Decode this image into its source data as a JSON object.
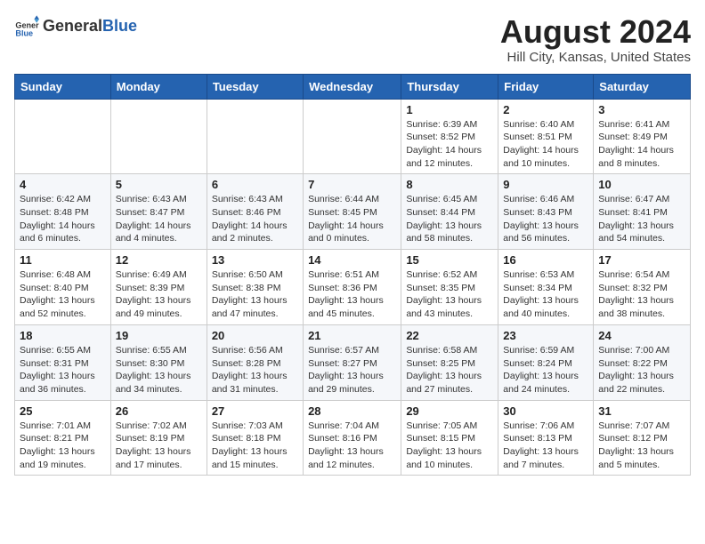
{
  "header": {
    "logo_general": "General",
    "logo_blue": "Blue",
    "month_year": "August 2024",
    "location": "Hill City, Kansas, United States"
  },
  "days_of_week": [
    "Sunday",
    "Monday",
    "Tuesday",
    "Wednesday",
    "Thursday",
    "Friday",
    "Saturday"
  ],
  "weeks": [
    [
      {
        "day": "",
        "info": ""
      },
      {
        "day": "",
        "info": ""
      },
      {
        "day": "",
        "info": ""
      },
      {
        "day": "",
        "info": ""
      },
      {
        "day": "1",
        "info": "Sunrise: 6:39 AM\nSunset: 8:52 PM\nDaylight: 14 hours and 12 minutes."
      },
      {
        "day": "2",
        "info": "Sunrise: 6:40 AM\nSunset: 8:51 PM\nDaylight: 14 hours and 10 minutes."
      },
      {
        "day": "3",
        "info": "Sunrise: 6:41 AM\nSunset: 8:49 PM\nDaylight: 14 hours and 8 minutes."
      }
    ],
    [
      {
        "day": "4",
        "info": "Sunrise: 6:42 AM\nSunset: 8:48 PM\nDaylight: 14 hours and 6 minutes."
      },
      {
        "day": "5",
        "info": "Sunrise: 6:43 AM\nSunset: 8:47 PM\nDaylight: 14 hours and 4 minutes."
      },
      {
        "day": "6",
        "info": "Sunrise: 6:43 AM\nSunset: 8:46 PM\nDaylight: 14 hours and 2 minutes."
      },
      {
        "day": "7",
        "info": "Sunrise: 6:44 AM\nSunset: 8:45 PM\nDaylight: 14 hours and 0 minutes."
      },
      {
        "day": "8",
        "info": "Sunrise: 6:45 AM\nSunset: 8:44 PM\nDaylight: 13 hours and 58 minutes."
      },
      {
        "day": "9",
        "info": "Sunrise: 6:46 AM\nSunset: 8:43 PM\nDaylight: 13 hours and 56 minutes."
      },
      {
        "day": "10",
        "info": "Sunrise: 6:47 AM\nSunset: 8:41 PM\nDaylight: 13 hours and 54 minutes."
      }
    ],
    [
      {
        "day": "11",
        "info": "Sunrise: 6:48 AM\nSunset: 8:40 PM\nDaylight: 13 hours and 52 minutes."
      },
      {
        "day": "12",
        "info": "Sunrise: 6:49 AM\nSunset: 8:39 PM\nDaylight: 13 hours and 49 minutes."
      },
      {
        "day": "13",
        "info": "Sunrise: 6:50 AM\nSunset: 8:38 PM\nDaylight: 13 hours and 47 minutes."
      },
      {
        "day": "14",
        "info": "Sunrise: 6:51 AM\nSunset: 8:36 PM\nDaylight: 13 hours and 45 minutes."
      },
      {
        "day": "15",
        "info": "Sunrise: 6:52 AM\nSunset: 8:35 PM\nDaylight: 13 hours and 43 minutes."
      },
      {
        "day": "16",
        "info": "Sunrise: 6:53 AM\nSunset: 8:34 PM\nDaylight: 13 hours and 40 minutes."
      },
      {
        "day": "17",
        "info": "Sunrise: 6:54 AM\nSunset: 8:32 PM\nDaylight: 13 hours and 38 minutes."
      }
    ],
    [
      {
        "day": "18",
        "info": "Sunrise: 6:55 AM\nSunset: 8:31 PM\nDaylight: 13 hours and 36 minutes."
      },
      {
        "day": "19",
        "info": "Sunrise: 6:55 AM\nSunset: 8:30 PM\nDaylight: 13 hours and 34 minutes."
      },
      {
        "day": "20",
        "info": "Sunrise: 6:56 AM\nSunset: 8:28 PM\nDaylight: 13 hours and 31 minutes."
      },
      {
        "day": "21",
        "info": "Sunrise: 6:57 AM\nSunset: 8:27 PM\nDaylight: 13 hours and 29 minutes."
      },
      {
        "day": "22",
        "info": "Sunrise: 6:58 AM\nSunset: 8:25 PM\nDaylight: 13 hours and 27 minutes."
      },
      {
        "day": "23",
        "info": "Sunrise: 6:59 AM\nSunset: 8:24 PM\nDaylight: 13 hours and 24 minutes."
      },
      {
        "day": "24",
        "info": "Sunrise: 7:00 AM\nSunset: 8:22 PM\nDaylight: 13 hours and 22 minutes."
      }
    ],
    [
      {
        "day": "25",
        "info": "Sunrise: 7:01 AM\nSunset: 8:21 PM\nDaylight: 13 hours and 19 minutes."
      },
      {
        "day": "26",
        "info": "Sunrise: 7:02 AM\nSunset: 8:19 PM\nDaylight: 13 hours and 17 minutes."
      },
      {
        "day": "27",
        "info": "Sunrise: 7:03 AM\nSunset: 8:18 PM\nDaylight: 13 hours and 15 minutes."
      },
      {
        "day": "28",
        "info": "Sunrise: 7:04 AM\nSunset: 8:16 PM\nDaylight: 13 hours and 12 minutes."
      },
      {
        "day": "29",
        "info": "Sunrise: 7:05 AM\nSunset: 8:15 PM\nDaylight: 13 hours and 10 minutes."
      },
      {
        "day": "30",
        "info": "Sunrise: 7:06 AM\nSunset: 8:13 PM\nDaylight: 13 hours and 7 minutes."
      },
      {
        "day": "31",
        "info": "Sunrise: 7:07 AM\nSunset: 8:12 PM\nDaylight: 13 hours and 5 minutes."
      }
    ]
  ]
}
